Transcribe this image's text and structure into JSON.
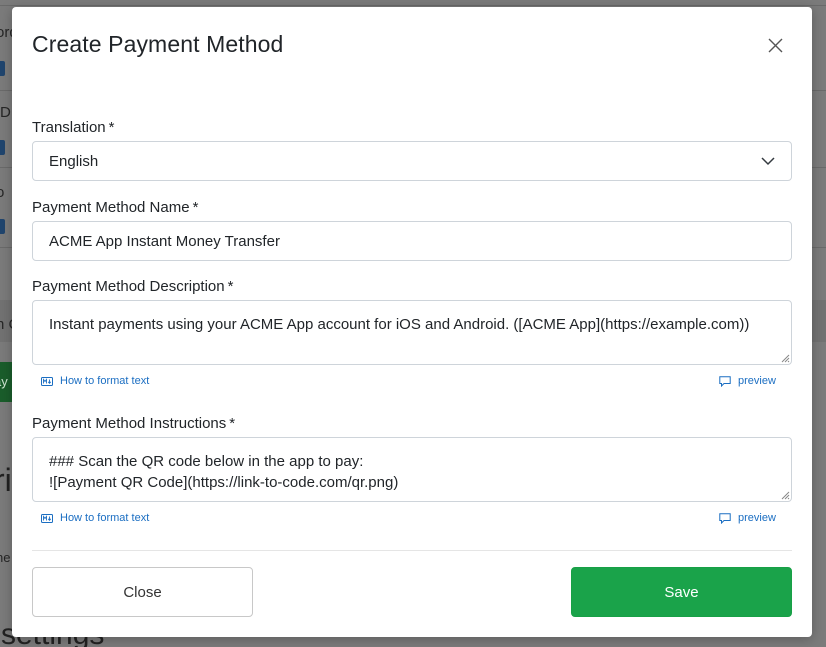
{
  "background": {
    "fragments": [
      "ord",
      "D",
      "o",
      "n C",
      "ay",
      "ri",
      "ne",
      "l settings"
    ]
  },
  "modal": {
    "title": "Create Payment Method",
    "close_icon": "close-icon",
    "translation": {
      "label": "Translation",
      "required_mark": "*",
      "selected": "English"
    },
    "name": {
      "label": "Payment Method Name",
      "required_mark": "*",
      "value": "ACME App Instant Money Transfer"
    },
    "description": {
      "label": "Payment Method Description",
      "required_mark": "*",
      "value": "Instant payments using your ACME App account for iOS and Android. ([ACME App](https://example.com))",
      "format_help": "How to format text",
      "preview": "preview"
    },
    "instructions": {
      "label": "Payment Method Instructions",
      "required_mark": "*",
      "lines": [
        "### Scan the QR code below in the app to pay:",
        "![Payment QR Code](https://link-to-code.com/qr.png)"
      ],
      "format_help": "How to format text",
      "preview": "preview"
    },
    "buttons": {
      "close": "Close",
      "save": "Save"
    },
    "colors": {
      "link": "#1b6ec2",
      "save": "#1aa34a"
    }
  }
}
